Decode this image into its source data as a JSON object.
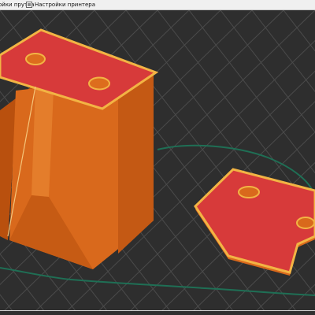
{
  "window": {
    "tabs": [
      {
        "label": "ойки прутка",
        "icon": "filament-settings-icon"
      },
      {
        "label": "Настройки принтера",
        "icon": "printer-settings-icon"
      }
    ]
  },
  "viewport": {
    "scene": "3d-print-plater",
    "objects": [
      {
        "name": "tall-block-model",
        "color": "#dd6d1d",
        "top_color": "#d73a3a",
        "holes": 2
      },
      {
        "name": "flat-l-plate-model",
        "color": "#e8872a",
        "top_color": "#d73a3a",
        "holes": 2
      }
    ],
    "colors": {
      "background": "#2e2e2e",
      "grid": "#4a4a4a",
      "model_body": "#d86a1e",
      "model_shade": "#b8520f",
      "top_surface": "#d73a3a",
      "perimeter": "#f2b444",
      "travel_path": "#1f6f55"
    }
  }
}
